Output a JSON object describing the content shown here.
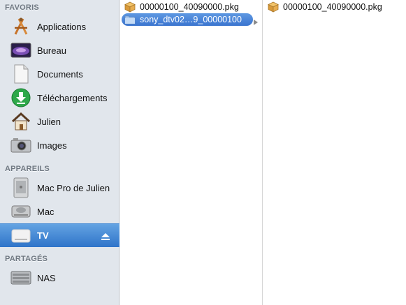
{
  "sidebar": {
    "sections": [
      {
        "title": "FAVORIS",
        "items": [
          {
            "label": "Applications",
            "icon": "applications-icon"
          },
          {
            "label": "Bureau",
            "icon": "desktop-icon"
          },
          {
            "label": "Documents",
            "icon": "documents-icon"
          },
          {
            "label": "Téléchargements",
            "icon": "downloads-icon"
          },
          {
            "label": "Julien",
            "icon": "home-icon"
          },
          {
            "label": "Images",
            "icon": "camera-icon"
          }
        ]
      },
      {
        "title": "APPAREILS",
        "items": [
          {
            "label": "Mac Pro de Julien",
            "icon": "mac-pro-icon"
          },
          {
            "label": "Mac",
            "icon": "hard-drive-icon"
          },
          {
            "label": "TV",
            "icon": "external-drive-icon",
            "selected": true
          }
        ]
      },
      {
        "title": "PARTAGÉS",
        "items": [
          {
            "label": "NAS",
            "icon": "network-server-icon"
          }
        ]
      }
    ]
  },
  "columns": [
    {
      "items": [
        {
          "name": "00000100_40090000.pkg",
          "icon": "package-icon"
        },
        {
          "name": "sony_dtv02…9_00000100",
          "icon": "folder-icon",
          "selected": true
        }
      ]
    },
    {
      "items": [
        {
          "name": "00000100_40090000.pkg",
          "icon": "package-icon"
        }
      ]
    }
  ],
  "colors": {
    "sidebar_bg": "#e1e6ec",
    "selection": "#3a74cf"
  }
}
